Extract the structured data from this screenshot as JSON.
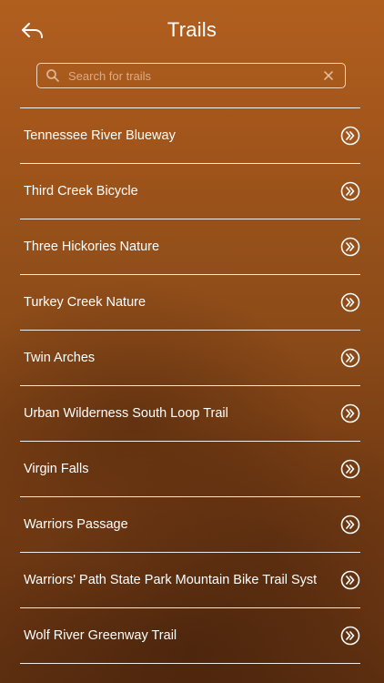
{
  "header": {
    "title": "Trails",
    "back_icon": "back-arrow-icon"
  },
  "search": {
    "placeholder": "Search for trails",
    "value": "",
    "icon": "search-icon",
    "clear_icon": "clear-icon"
  },
  "trails": [
    {
      "label": "Tennessee River Blueway"
    },
    {
      "label": "Third Creek Bicycle"
    },
    {
      "label": "Three Hickories Nature"
    },
    {
      "label": "Turkey Creek Nature"
    },
    {
      "label": "Twin Arches"
    },
    {
      "label": "Urban Wilderness South Loop Trail"
    },
    {
      "label": "Virgin Falls"
    },
    {
      "label": "Warriors Passage"
    },
    {
      "label": "Warriors' Path State Park Mountain Bike Trail Syst"
    },
    {
      "label": "Wolf River Greenway Trail"
    }
  ],
  "row_icon": "chevron-right-double-icon",
  "colors": {
    "background_top": "#b05f1f",
    "background_bottom": "#5e2f10",
    "text": "#ffffff"
  }
}
